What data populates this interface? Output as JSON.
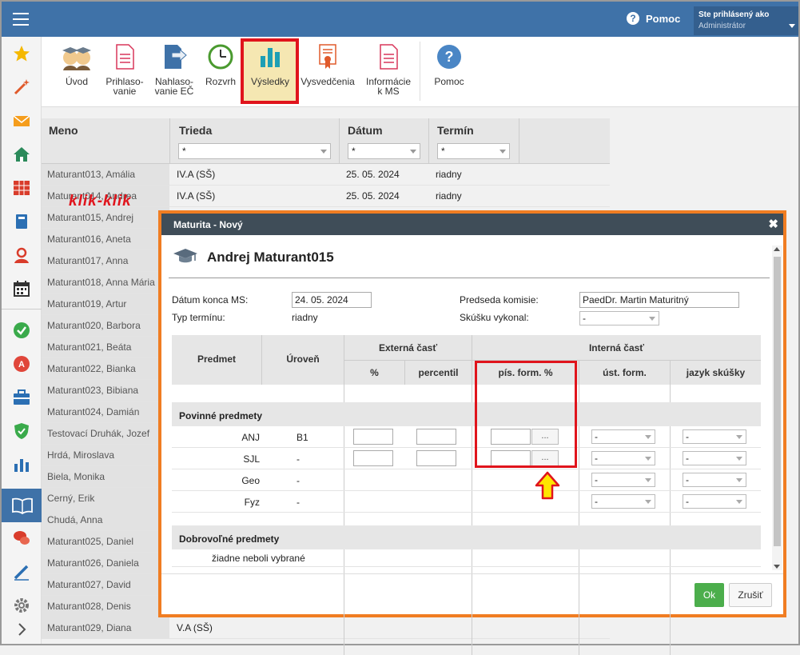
{
  "topbar": {
    "help": "Pomoc",
    "user_line1": "Ste prihlásený ako",
    "user_line2": "Administrátor"
  },
  "toolbar": {
    "uvod": "Úvod",
    "prihlasovanie_1": "Prihlaso-",
    "prihlasovanie_2": "vanie",
    "nahlasovanie_1": "Nahlaso-",
    "nahlasovanie_2": "vanie EČ",
    "rozvrh": "Rozvrh",
    "vysledky": "Výsledky",
    "vysvedcenia": "Vysvedčenia",
    "informacie_1": "Informácie",
    "informacie_2": "k MS",
    "pomoc": "Pomoc"
  },
  "grid": {
    "headers": {
      "meno": "Meno",
      "trieda": "Trieda",
      "datum": "Dátum",
      "termin": "Termín"
    },
    "filter": "*",
    "rows": [
      {
        "name": "Maturant013, Amália",
        "class": "IV.A (SŠ)",
        "date": "25. 05. 2024",
        "term": "riadny"
      },
      {
        "name": "Maturant014, Andrea",
        "class": "IV.A (SŠ)",
        "date": "25. 05. 2024",
        "term": "riadny"
      },
      {
        "name": "Maturant015, Andrej",
        "class": "",
        "date": "",
        "term": ""
      },
      {
        "name": "Maturant016, Aneta",
        "class": "",
        "date": "",
        "term": ""
      },
      {
        "name": "Maturant017, Anna",
        "class": "",
        "date": "",
        "term": ""
      },
      {
        "name": "Maturant018, Anna Mária",
        "class": "",
        "date": "",
        "term": ""
      },
      {
        "name": "Maturant019, Artur",
        "class": "",
        "date": "",
        "term": ""
      },
      {
        "name": "Maturant020, Barbora",
        "class": "",
        "date": "",
        "term": ""
      },
      {
        "name": "Maturant021, Beáta",
        "class": "",
        "date": "",
        "term": ""
      },
      {
        "name": "Maturant022, Bianka",
        "class": "",
        "date": "",
        "term": ""
      },
      {
        "name": "Maturant023, Bibiana",
        "class": "",
        "date": "",
        "term": ""
      },
      {
        "name": "Maturant024, Damián",
        "class": "",
        "date": "",
        "term": ""
      },
      {
        "name": "Testovací Druhák, Jozef",
        "class": "",
        "date": "",
        "term": ""
      },
      {
        "name": "Hrdá, Miroslava",
        "class": "",
        "date": "",
        "term": ""
      },
      {
        "name": "Biela, Monika",
        "class": "",
        "date": "",
        "term": ""
      },
      {
        "name": "Cerný, Erik",
        "class": "",
        "date": "",
        "term": ""
      },
      {
        "name": "Chudá, Anna",
        "class": "",
        "date": "",
        "term": ""
      },
      {
        "name": "Maturant025, Daniel",
        "class": "",
        "date": "",
        "term": ""
      },
      {
        "name": "Maturant026, Daniela",
        "class": "",
        "date": "",
        "term": ""
      },
      {
        "name": "Maturant027, David",
        "class": "",
        "date": "",
        "term": ""
      },
      {
        "name": "Maturant028, Denis",
        "class": "",
        "date": "",
        "term": ""
      },
      {
        "name": "Maturant029, Diana",
        "class": "V.A (SŠ)",
        "date": "",
        "term": ""
      }
    ],
    "annotation": "klik-klik"
  },
  "modal": {
    "title": "Maturita - Nový",
    "student": "Andrej Maturant015",
    "datum_konca_label": "Dátum konca MS:",
    "datum_konca_value": "24. 05. 2024",
    "typ_terminu_label": "Typ termínu:",
    "typ_terminu_value": "riadny",
    "predseda_label": "Predseda komisie:",
    "predseda_value": "PaedDr. Martin Maturitný",
    "skusku_label": "Skúšku vykonal:",
    "skusku_value": "-",
    "table": {
      "predmet": "Predmet",
      "uroven": "Úroveň",
      "externa": "Externá časť",
      "interna": "Interná časť",
      "percent": "%",
      "percentil": "percentil",
      "pis_form": "pís. form. %",
      "ust_form": "úst. form.",
      "jazyk": "jazyk skúšky",
      "povinne": "Povinné predmety",
      "dobrovolne": "Dobrovoľné predmety",
      "ziadne": "žiadne neboli vybrané",
      "dots": "...",
      "dash": "-",
      "subjects": [
        {
          "name": "ANJ",
          "level": "B1"
        },
        {
          "name": "SJL",
          "level": "-"
        },
        {
          "name": "Geo",
          "level": "-"
        },
        {
          "name": "Fyz",
          "level": "-"
        }
      ]
    },
    "ok": "Ok",
    "cancel": "Zrušiť"
  },
  "colors": {
    "topbar": "#3f72a8",
    "modal_border": "#f07d22",
    "highlight": "#e0141c",
    "ok": "#4cae4c",
    "arrow": "#ffe600"
  }
}
